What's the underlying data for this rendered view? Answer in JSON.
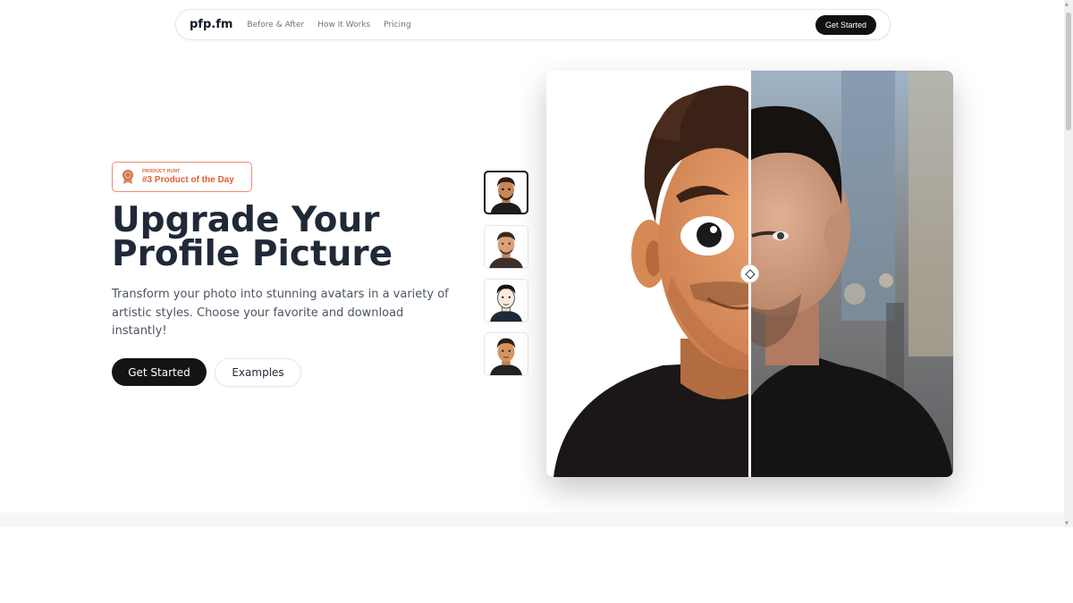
{
  "nav": {
    "brand": "pfp.fm",
    "links": [
      "Before & After",
      "How It Works",
      "Pricing"
    ],
    "cta": "Get Started"
  },
  "badge": {
    "small": "PRODUCT HUNT",
    "main": "#3 Product of the Day",
    "icon": "medal-icon",
    "color": "#e05d3c"
  },
  "hero": {
    "title_line1": "Upgrade Your",
    "title_line2": "Profile Picture",
    "subtitle": "Transform your photo into stunning avatars in a variety of artistic styles. Choose your favorite and download instantly!",
    "primary_button": "Get Started",
    "secondary_button": "Examples"
  },
  "styles": {
    "thumbnails": [
      "3d-cartoon-avatar",
      "illustrated-avatar",
      "line-art-avatar",
      "flat-avatar"
    ],
    "selected": "3d-cartoon-avatar"
  },
  "comparison": {
    "left": "cartoon-avatar-image",
    "right": "photo-portrait-image",
    "slider_position": 0.5,
    "handle_icon": "diamond-handle-icon"
  }
}
